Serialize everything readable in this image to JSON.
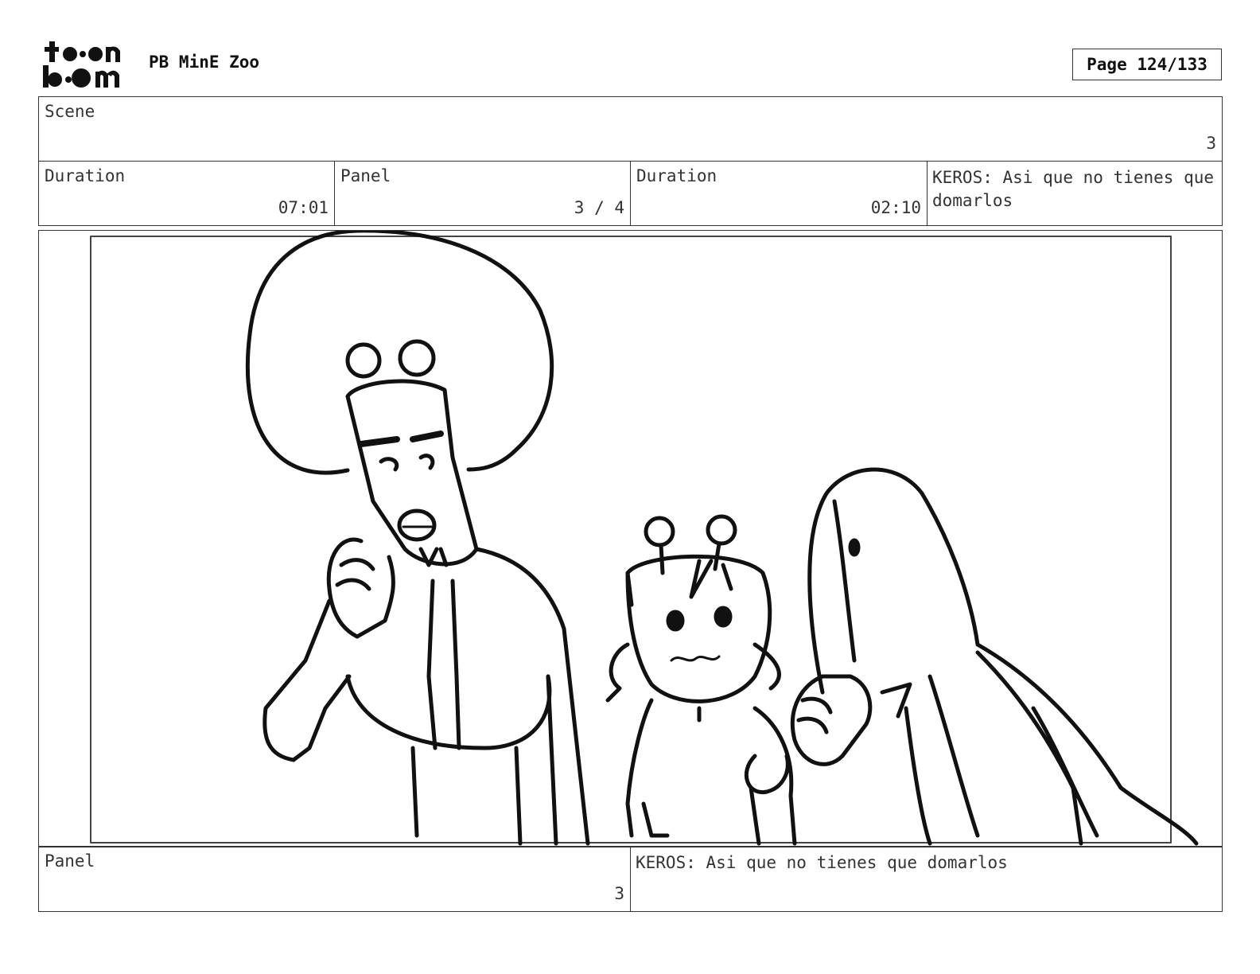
{
  "header": {
    "logo_text": "toon boom",
    "project": "PB MinE Zoo",
    "page": "Page 124/133"
  },
  "scene": {
    "label": "Scene",
    "value": "3"
  },
  "info": {
    "duration1_label": "Duration",
    "duration1_value": "07:01",
    "panel_label": "Panel",
    "panel_value": "3 / 4",
    "duration2_label": "Duration",
    "duration2_value": "02:10",
    "dialogue": "KEROS: Asi que no tienes que domarlos"
  },
  "footer": {
    "panel_label": "Panel",
    "panel_value": "3",
    "dialogue": "KEROS: Asi que no tienes que domarlos"
  }
}
